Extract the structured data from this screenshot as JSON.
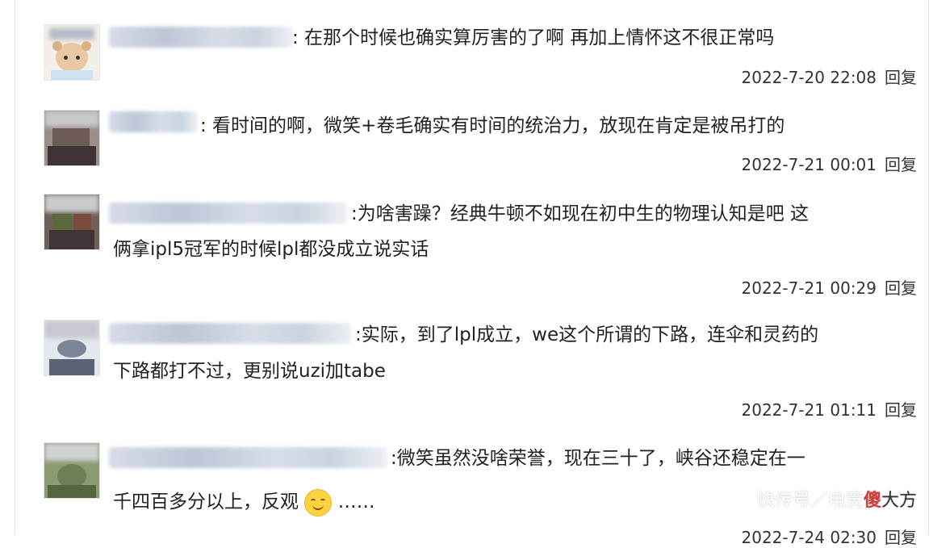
{
  "comments": [
    {
      "text_lines": [
        ": 在那个时候也确实算厉害的了啊 再加上情怀这不很正常吗"
      ],
      "date": "2022-7-20 22:08",
      "reply": "回复"
    },
    {
      "text_lines": [
        ": 看时间的啊，微笑+卷毛确实有时间的统治力，放现在肯定是被吊打的"
      ],
      "date": "2022-7-21 00:01",
      "reply": "回复"
    },
    {
      "text_lines": [
        ":为啥害躁？经典牛顿不如现在初中生的物理认知是吧 这",
        "俩拿ipl5冠军的时候lpl都没成立说实话"
      ],
      "date": "2022-7-21 00:29",
      "reply": "回复"
    },
    {
      "text_lines": [
        ":实际，到了lpl成立，we这个所谓的下路，连伞和灵药的",
        "下路都打不过，更别说uzi加tabe"
      ],
      "date": "2022-7-21 01:11",
      "reply": "回复"
    },
    {
      "text_lines": [
        ":微笑虽然没啥荣誉，现在三十了，峡谷还稳定在一",
        "千四百多分以上，反观"
      ],
      "trailing": "……",
      "emoji": "smile-emoji",
      "date": "2022-7-24 02:30",
      "reply": "回复"
    }
  ],
  "watermark": {
    "prefix": "快传号／电竞",
    "logo": "傻",
    "name": "大方"
  }
}
